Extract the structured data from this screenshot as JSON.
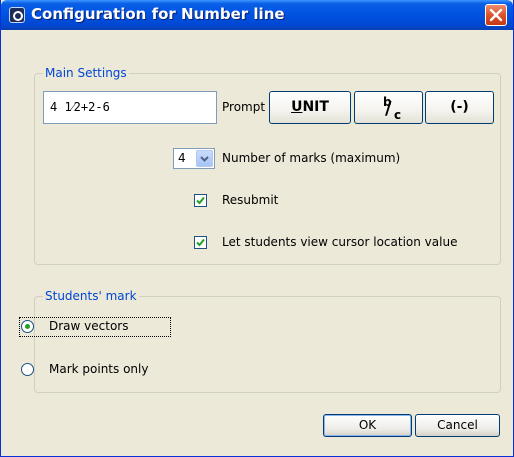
{
  "window": {
    "title": "Configuration for Number line"
  },
  "main_settings": {
    "legend": "Main Settings",
    "prompt_value": "4 1⁄2+2-6",
    "prompt_label": "Prompt",
    "unit_button": {
      "prefix": "",
      "mnemonic": "U",
      "suffix": "NIT"
    },
    "fraction_button": {
      "numerator": "b",
      "slash": "/",
      "denominator": "c"
    },
    "negative_button": "(-)",
    "marks_count": "4",
    "marks_label": "Number of marks (maximum)",
    "resubmit_label": "Resubmit",
    "resubmit_checked": true,
    "cursor_label": "Let students view cursor location value",
    "cursor_checked": true
  },
  "students_mark": {
    "legend": "Students' mark",
    "option_vectors": "Draw vectors",
    "option_points": "Mark points only",
    "selected": "Draw vectors"
  },
  "footer": {
    "ok": "OK",
    "cancel": "Cancel"
  },
  "colors": {
    "title_bar": "#0153e3",
    "group_label": "#0046d5",
    "dialog_bg": "#ece9d8",
    "check": "#21a121"
  }
}
